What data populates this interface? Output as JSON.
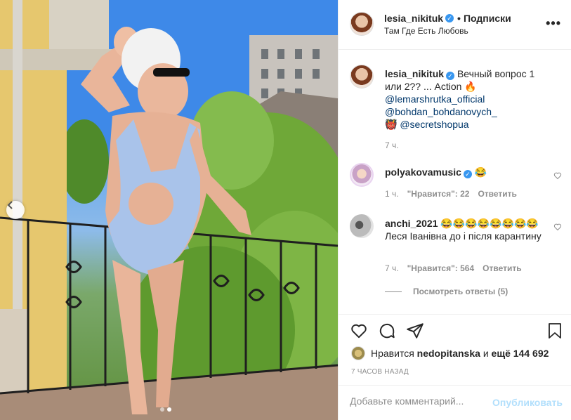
{
  "post": {
    "author": "lesia_nikituk",
    "follow_label": "Подписки",
    "location": "Там Где Есть Любовь",
    "more_label": "•••",
    "caption": {
      "author": "lesia_nikituk",
      "text": "Вечный вопрос 1 или 2?? ... Action 🔥",
      "mentions": [
        "@lemarshrutka_official",
        "@bohdan_bohdanovych_",
        "@secretshopua"
      ],
      "mention_prefix_emoji": "👹",
      "time": "7 ч."
    },
    "comments": [
      {
        "author": "polyakovamusic",
        "verified": true,
        "text": "😂",
        "time": "1 ч.",
        "likes": "\"Нравится\": 22",
        "reply": "Ответить"
      },
      {
        "author": "anchi_2021",
        "verified": false,
        "text": "😂😂😂😂😂😂😂😂Леся Іванівна до і після карантину",
        "time": "7 ч.",
        "likes": "\"Нравится\": 564",
        "reply": "Ответить",
        "view_replies": "Посмотреть ответы (5)"
      }
    ],
    "likes_line": {
      "prefix": "Нравится",
      "user": "nedopitanska",
      "middle": "и",
      "rest": "ещё 144 692"
    },
    "timestamp": "7 ЧАСОВ НАЗАД",
    "comment_placeholder": "Добавьте комментарий...",
    "publish_label": "Опубликовать"
  },
  "colors": {
    "link": "#00376b",
    "verified": "#3897f0",
    "muted": "#8e8e8e",
    "publish_disabled": "#b2dffc"
  },
  "icons": [
    "chevron-left-icon",
    "heart-icon",
    "comment-icon",
    "share-icon",
    "bookmark-icon",
    "verified-icon",
    "more-icon"
  ]
}
